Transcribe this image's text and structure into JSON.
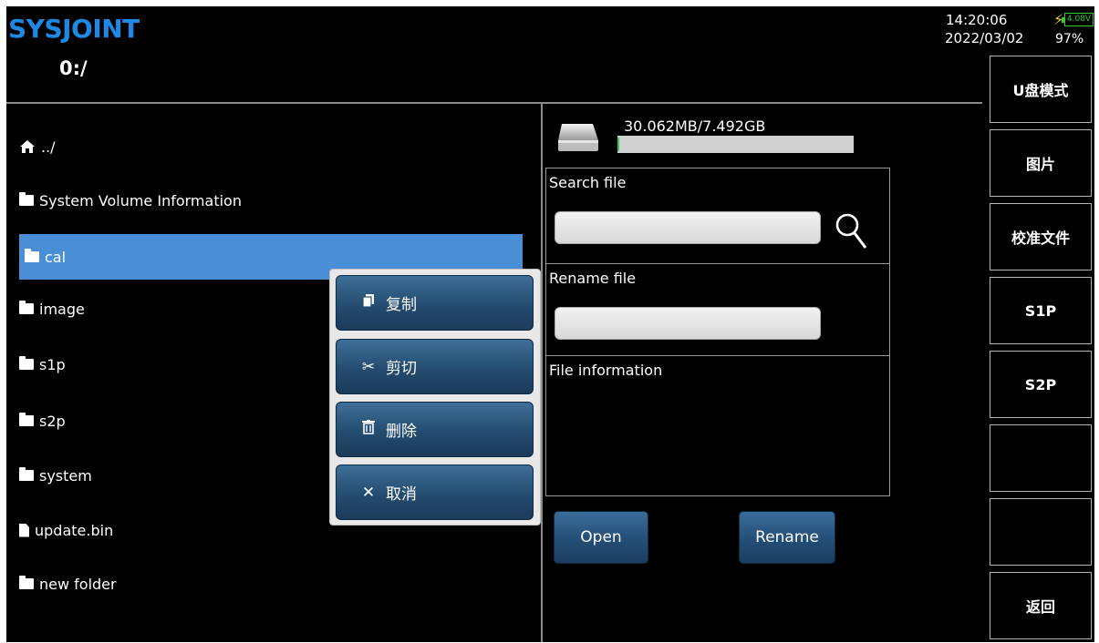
{
  "header": {
    "logo": "SYSJOINT",
    "path": "0:/",
    "time": "14:20:06",
    "date": "2022/03/02",
    "battery_voltage": "4.08V",
    "battery_percent": "97%"
  },
  "files": [
    {
      "name": "../",
      "type": "home-icon"
    },
    {
      "name": "System Volume Information",
      "type": "folder-icon"
    },
    {
      "name": "cal",
      "type": "folder-icon",
      "selected": true
    },
    {
      "name": "image",
      "type": "folder-icon"
    },
    {
      "name": "s1p",
      "type": "folder-icon"
    },
    {
      "name": "s2p",
      "type": "folder-icon"
    },
    {
      "name": "system",
      "type": "folder-icon"
    },
    {
      "name": "update.bin",
      "type": "file-icon"
    },
    {
      "name": "new folder",
      "type": "folder-icon"
    }
  ],
  "context_menu": {
    "copy": "复制",
    "cut": "剪切",
    "delete": "删除",
    "cancel": "取消"
  },
  "storage": {
    "capacity": "30.062MB/7.492GB",
    "used_fraction": 0.004
  },
  "panel": {
    "search_label": "Search file",
    "search_value": "",
    "rename_label": "Rename file",
    "rename_value": "",
    "info_label": "File information",
    "open_button": "Open",
    "rename_button": "Rename"
  },
  "softkeys": [
    "U盘模式",
    "图片",
    "校准文件",
    "S1P",
    "S2P",
    "",
    "",
    "返回"
  ],
  "colors": {
    "logo": "#1e88e5",
    "selection": "#4a8fd6",
    "button": "#2a557c",
    "battery": "#33cc33",
    "bolt": "#ffd21f"
  }
}
